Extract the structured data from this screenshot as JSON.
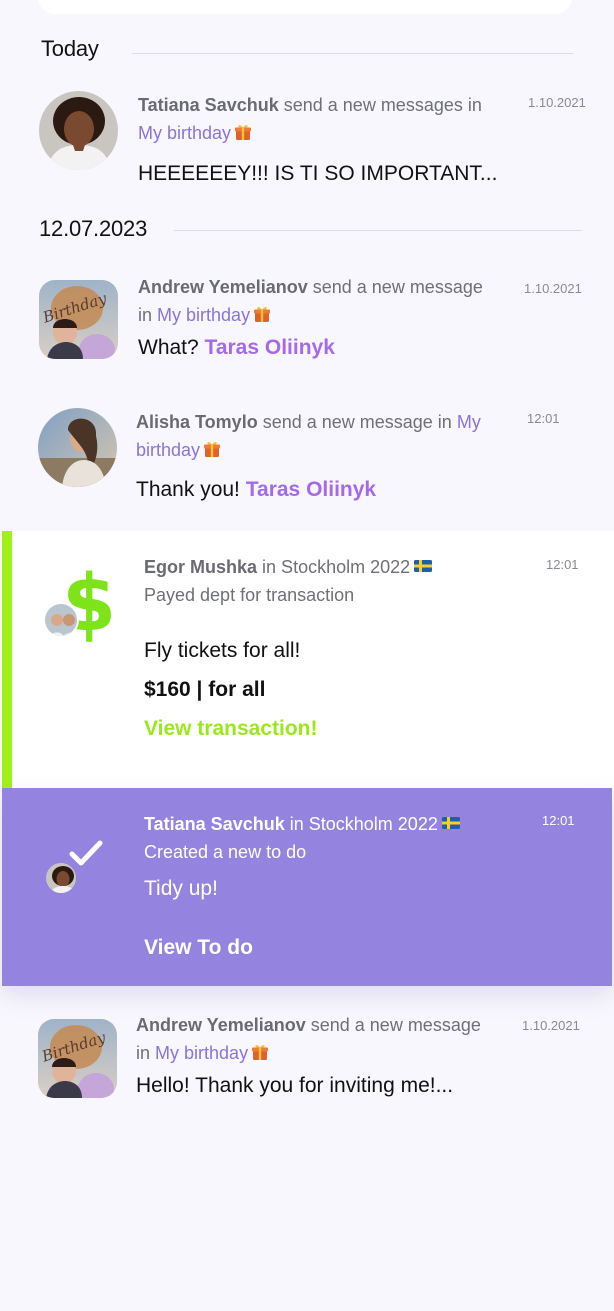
{
  "sections": {
    "today": "Today",
    "date": "12.07.2023"
  },
  "notifications": [
    {
      "author": "Tatiana Savchuk",
      "action": "send a new messages in",
      "chat": "My birthday",
      "time": "1.10.2021",
      "text": "HEEEEEEY!!! IS TI SO IMPORTANT..."
    },
    {
      "author": "Andrew Yemelianov",
      "action": "send a new message",
      "chat_prefix": "in",
      "chat": "My birthday",
      "time": "1.10.2021",
      "text": "What?",
      "mention": "Taras Oliinyk"
    },
    {
      "author": "Alisha Tomylo",
      "action": "send a new message in",
      "chat_part1": "My",
      "chat_part2": "birthday",
      "time": "12:01",
      "text": "Thank you!",
      "mention": "Taras Oliinyk"
    },
    {
      "author": "Egor Mushka",
      "action": "in Stockholm 2022",
      "subtitle": "Payed dept for transaction",
      "time": "12:01",
      "text": "Fly tickets for all!",
      "amount": "$160 | for all",
      "link": "View transaction!",
      "icon_glyph": "$"
    },
    {
      "author": "Tatiana Savchuk",
      "action": "in Stockholm 2022",
      "subtitle": "Created a new to do",
      "time": "12:01",
      "text": "Tidy up!",
      "link": "View To do"
    },
    {
      "author": "Andrew Yemelianov",
      "action": "send a new message",
      "chat_prefix": "in",
      "chat": "My birthday",
      "time": "1.10.2021",
      "text": "Hello! Thank you for inviting me!..."
    }
  ],
  "icons": {
    "gift": "gift-icon",
    "flag": "sweden-flag-icon",
    "dollar": "dollar-icon",
    "check": "checkmark-icon"
  },
  "colors": {
    "background": "#f8f7fe",
    "accent_purple": "#9584df",
    "link_purple": "#8a74d8",
    "mention_purple": "#a46ae8",
    "accent_green": "#a2f116",
    "dollar_green": "#7fe319"
  }
}
